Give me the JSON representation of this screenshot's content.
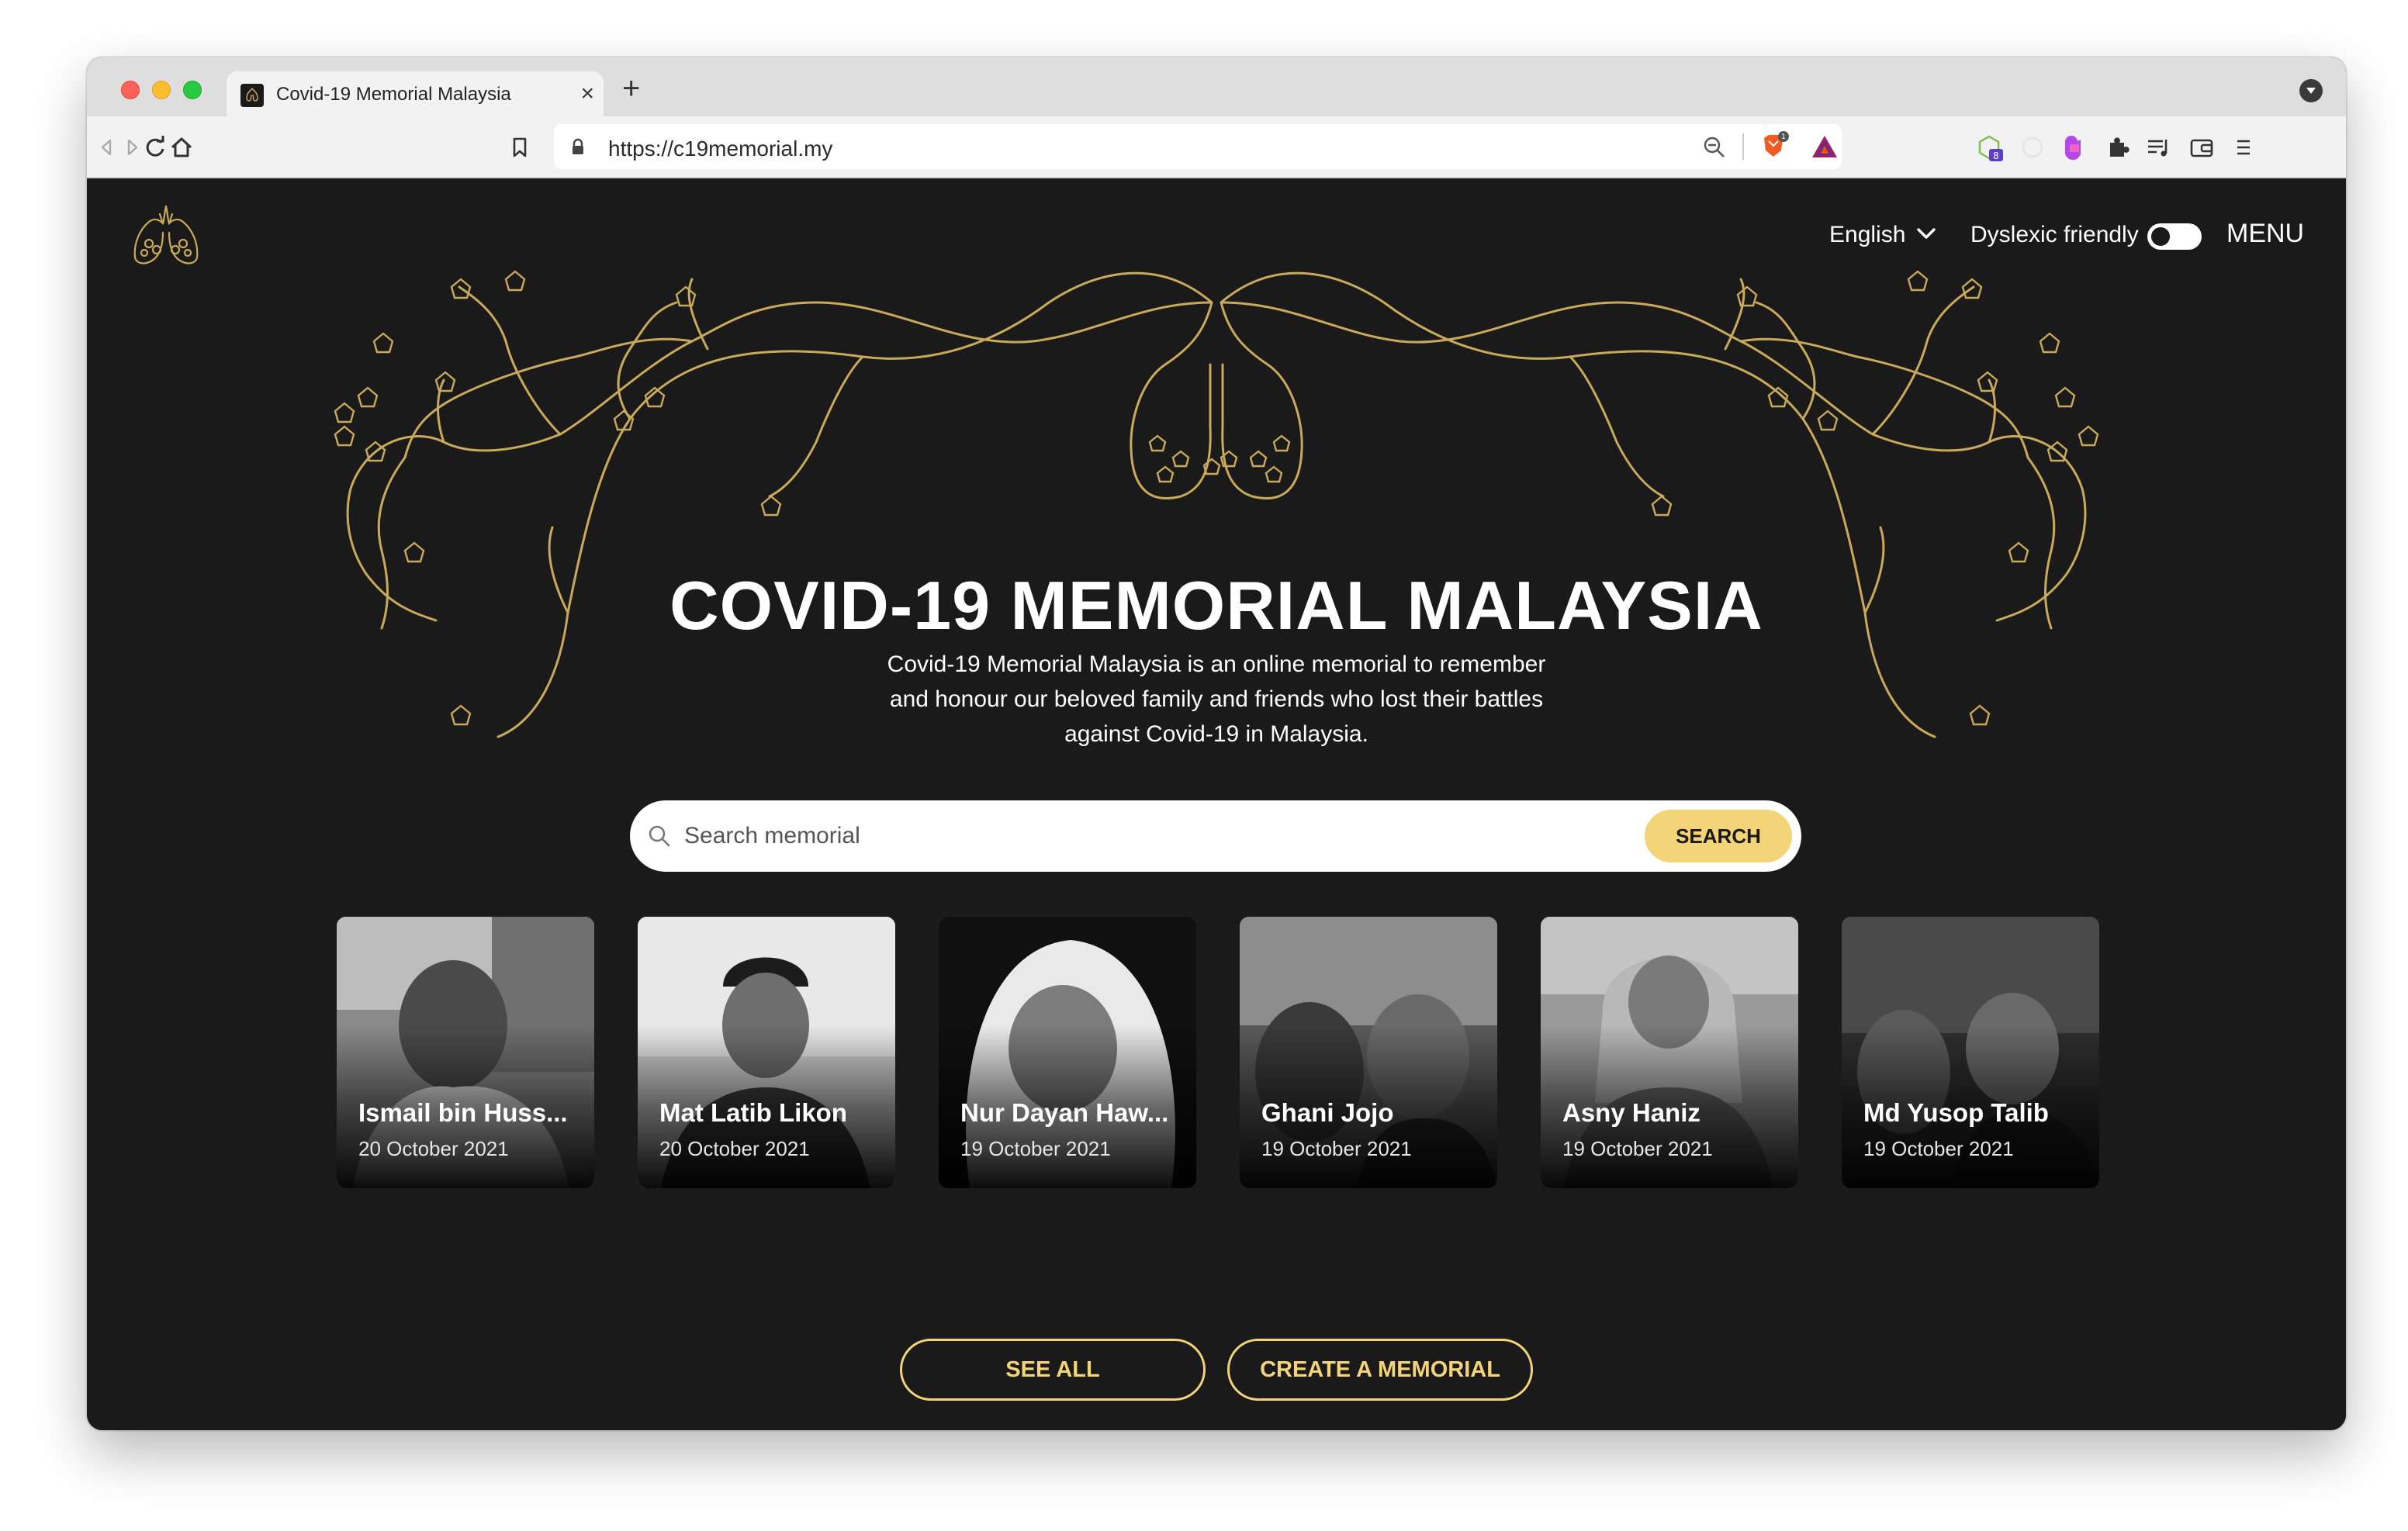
{
  "browser": {
    "tab_title": "Covid-19 Memorial Malaysia",
    "url": "https://c19memorial.my",
    "shield_badge": "1",
    "extension_badge": "8"
  },
  "header": {
    "language": "English",
    "dyslexic_label": "Dyslexic friendly",
    "dyslexic_enabled": false,
    "menu_label": "MENU"
  },
  "hero": {
    "title": "COVID-19 MEMORIAL MALAYSIA",
    "description": "Covid-19 Memorial Malaysia is an online memorial to remember and honour our beloved family and friends who lost their battles against Covid-19 in Malaysia."
  },
  "search": {
    "placeholder": "Search memorial",
    "button_label": "SEARCH"
  },
  "memorials": [
    {
      "name": "Ismail bin Huss...",
      "date": "20 October 2021"
    },
    {
      "name": "Mat Latib Likon",
      "date": "20 October 2021"
    },
    {
      "name": "Nur Dayan Haw...",
      "date": "19 October 2021"
    },
    {
      "name": "Ghani Jojo",
      "date": "19 October 2021"
    },
    {
      "name": "Asny Haniz",
      "date": "19 October 2021"
    },
    {
      "name": "Md Yusop Talib",
      "date": "19 October 2021"
    }
  ],
  "actions": {
    "see_all": "SEE ALL",
    "create": "CREATE A MEMORIAL"
  },
  "colors": {
    "background": "#1a1a1a",
    "accent": "#f4d479",
    "ornament": "#c9a95a"
  }
}
